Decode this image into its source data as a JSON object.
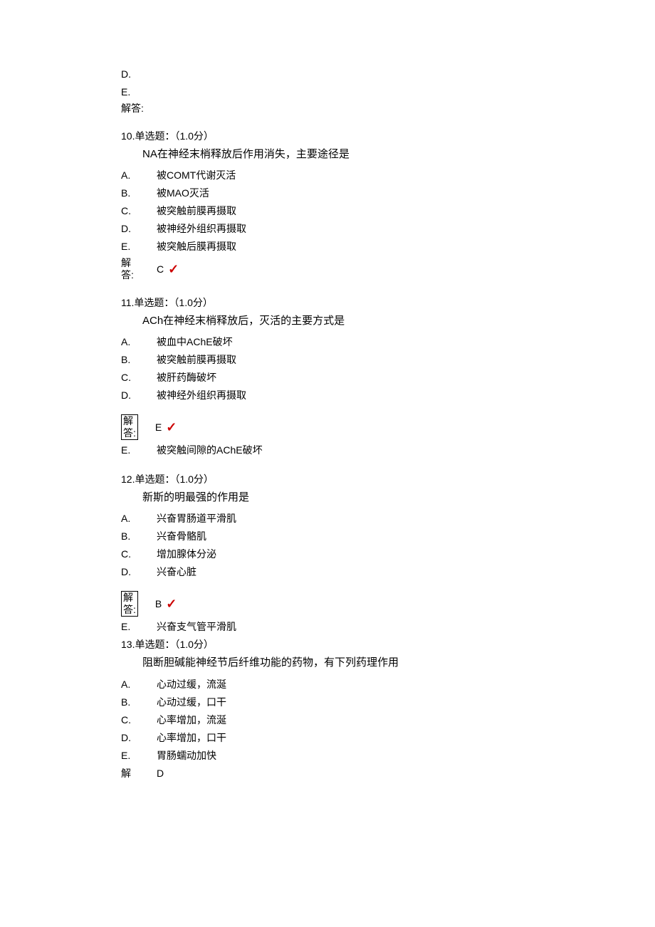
{
  "partial_top": {
    "opt_d": "D.",
    "opt_e": "E.",
    "ans_label": "解答:"
  },
  "q10": {
    "header": "10.单选题：（1.0分）",
    "stem": "NA在神经末梢释放后作用消失，主要途径是",
    "opts": {
      "A": "被COMT代谢灭活",
      "B": "被MAO灭活",
      "C": "被突触前膜再摄取",
      "D": "被神经外组织再摄取",
      "E": "被突触后膜再摄取"
    },
    "ans_label": "解答:",
    "ans_value": "C"
  },
  "q11": {
    "header": "11.单选题：（1.0分）",
    "stem": "ACh在神经末梢释放后，灭活的主要方式是",
    "opts": {
      "A": "被血中AChE破坏",
      "B": "被突触前膜再摄取",
      "C": "被肝药酶破坏",
      "D": "被神经外组织再摄取",
      "E": "被突触间隙的AChE破坏"
    },
    "ans_label": "解答:",
    "ans_value": "E"
  },
  "q12": {
    "header": "12.单选题：（1.0分）",
    "stem": "新斯的明最强的作用是",
    "opts": {
      "A": "兴奋胃肠道平滑肌",
      "B": "兴奋骨骼肌",
      "C": "增加腺体分泌",
      "D": "兴奋心脏",
      "E": "兴奋支气管平滑肌"
    },
    "ans_label": "解答:",
    "ans_value": "B"
  },
  "q13": {
    "header": "13.单选题：（1.0分）",
    "stem": "阻断胆碱能神经节后纤维功能的药物，有下列药理作用",
    "opts": {
      "A": "心动过缓，流涎",
      "B": "心动过缓，口干",
      "C": "心率增加，流涎",
      "D": "心率增加，口干",
      "E": "胃肠蠕动加快"
    },
    "ans_label": "解",
    "ans_value": "D"
  },
  "letters": {
    "A": "A.",
    "B": "B.",
    "C": "C.",
    "D": "D.",
    "E": "E."
  }
}
